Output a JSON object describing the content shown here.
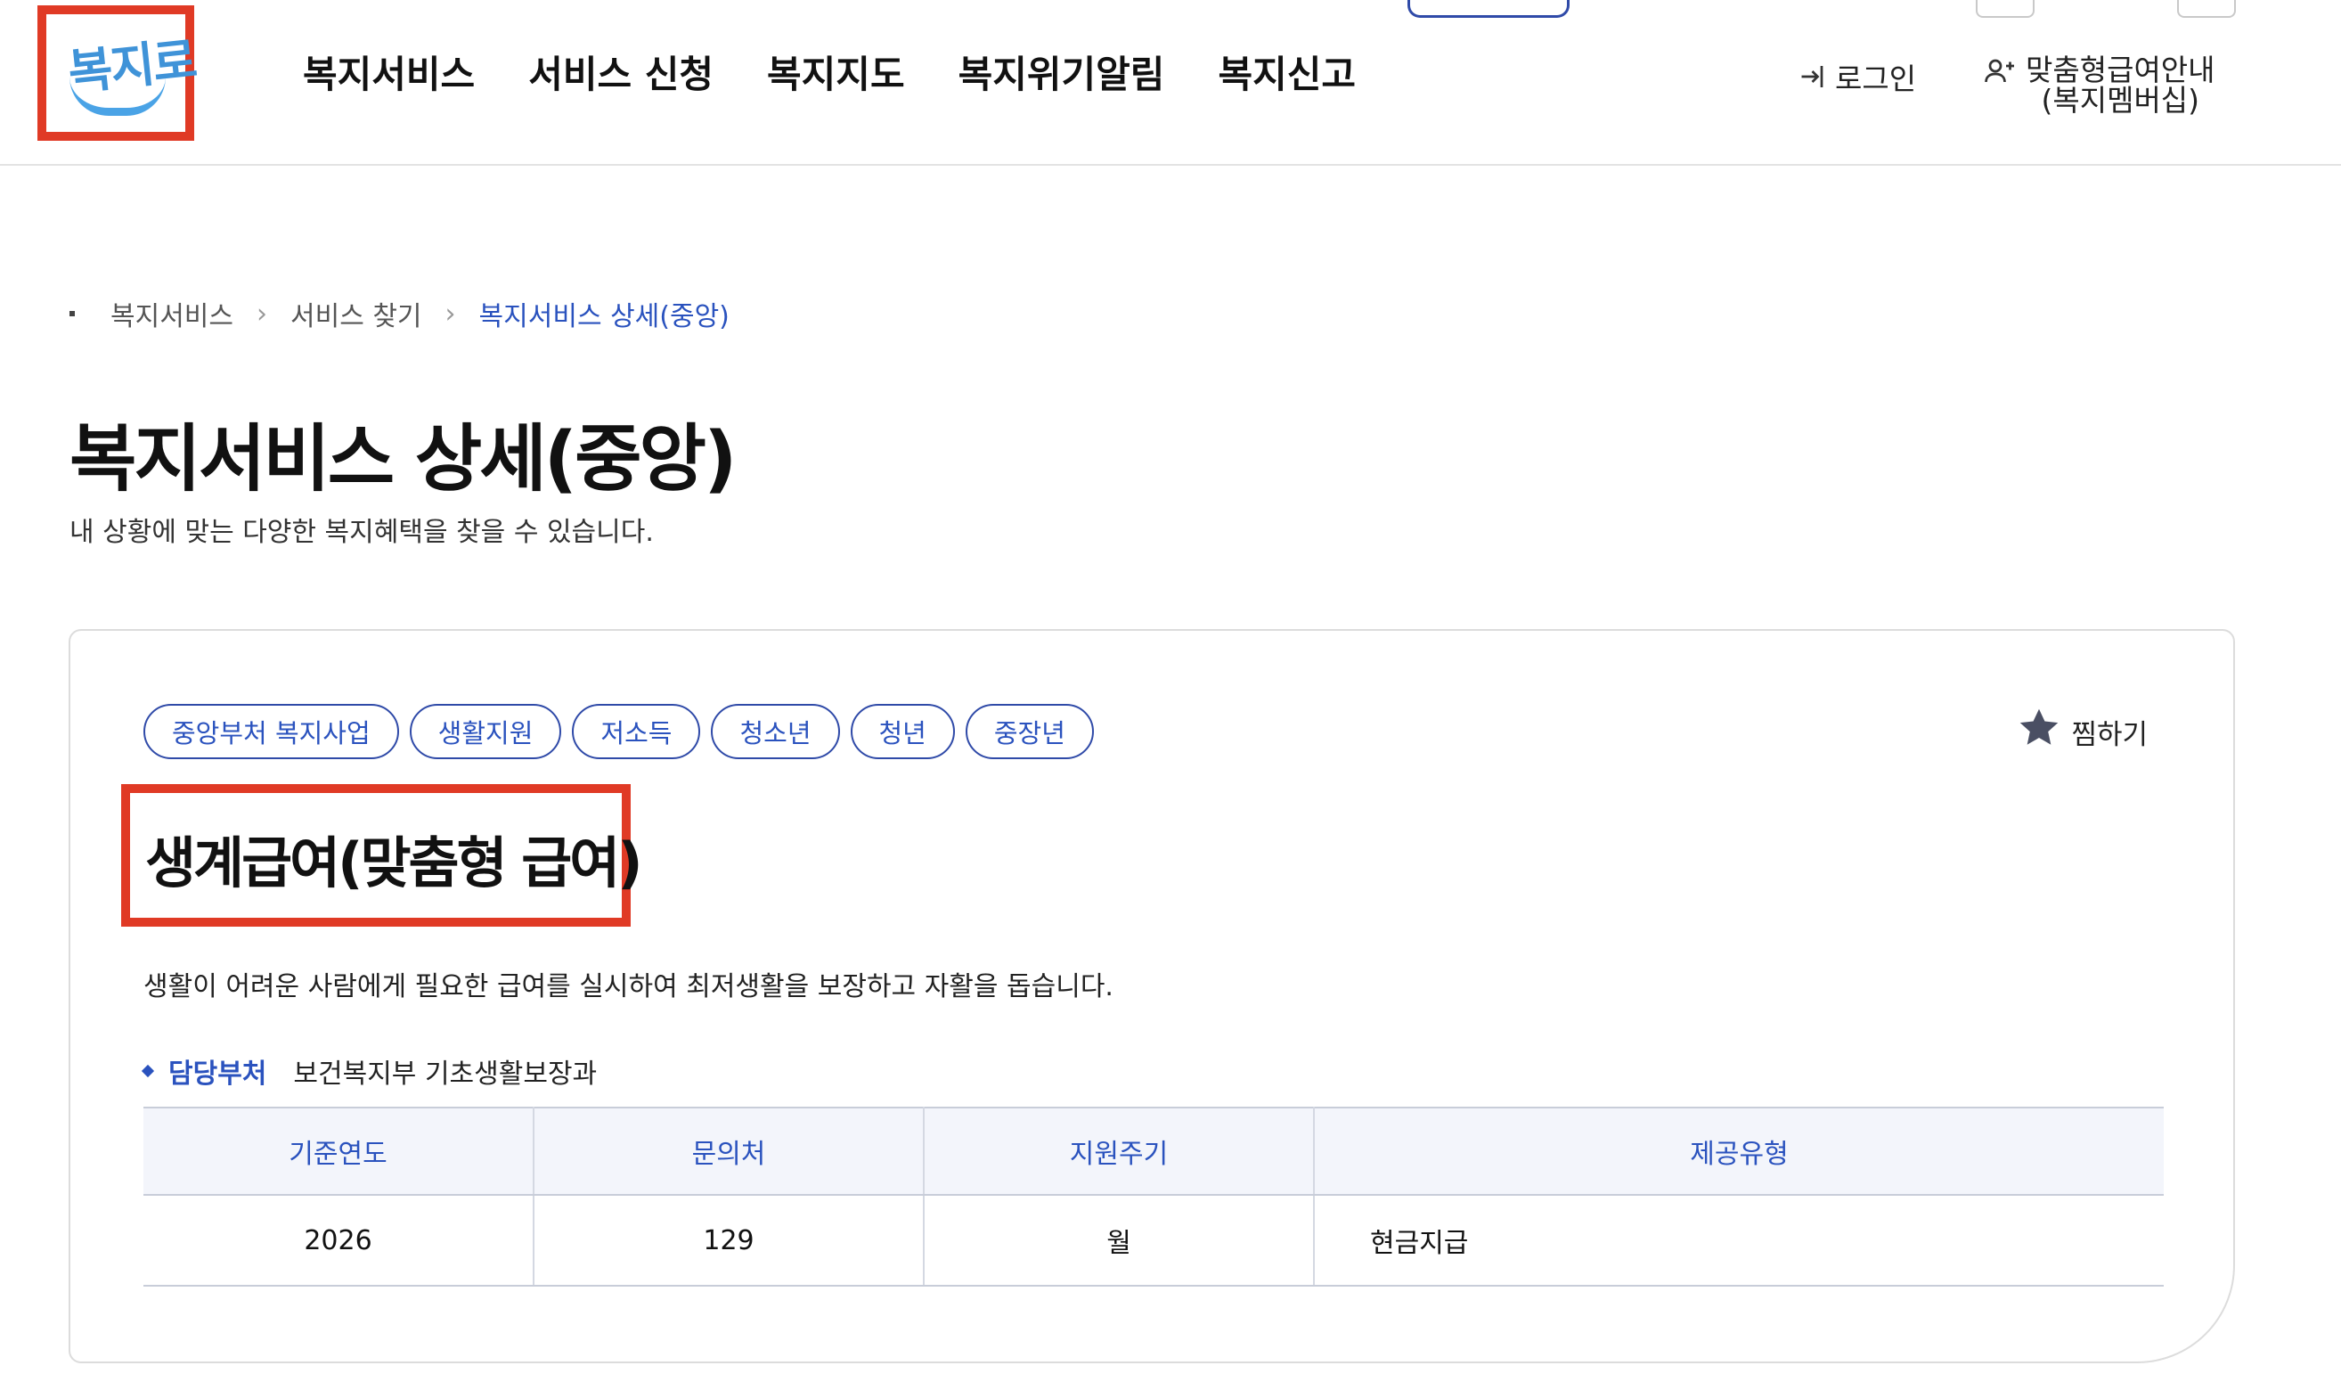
{
  "header": {
    "logo_text": "복지로",
    "gnb": [
      "복지서비스",
      "서비스 신청",
      "복지지도",
      "복지위기알림",
      "복지신고"
    ],
    "login_label": "로그인",
    "member_line1": "맞춤형급여안내",
    "member_line2": "(복지멤버십)"
  },
  "breadcrumb": [
    "복지서비스",
    "서비스 찾기",
    "복지서비스 상세(중앙)"
  ],
  "page": {
    "title": "복지서비스 상세(중앙)",
    "description": "내 상황에 맞는 다양한 복지혜택을 찾을 수 있습니다."
  },
  "service": {
    "tags": [
      "중앙부처 복지사업",
      "생활지원",
      "저소득",
      "청소년",
      "청년",
      "중장년"
    ],
    "bookmark_label": "찜하기",
    "title": "생계급여(맞춤형 급여)",
    "description": "생활이 어려운 사람에게 필요한 급여를 실시하여 최저생활을 보장하고 자활을 돕습니다.",
    "dept_label": "담당부처",
    "dept_value": "보건복지부 기초생활보장과",
    "table": {
      "headers": [
        "기준연도",
        "문의처",
        "지원주기",
        "제공유형"
      ],
      "row": [
        "2026",
        "129",
        "월",
        "현금지급"
      ]
    }
  },
  "colors": {
    "accent": "#2a52be",
    "highlight_box": "#e03a25",
    "logo": "#3f93d8"
  }
}
